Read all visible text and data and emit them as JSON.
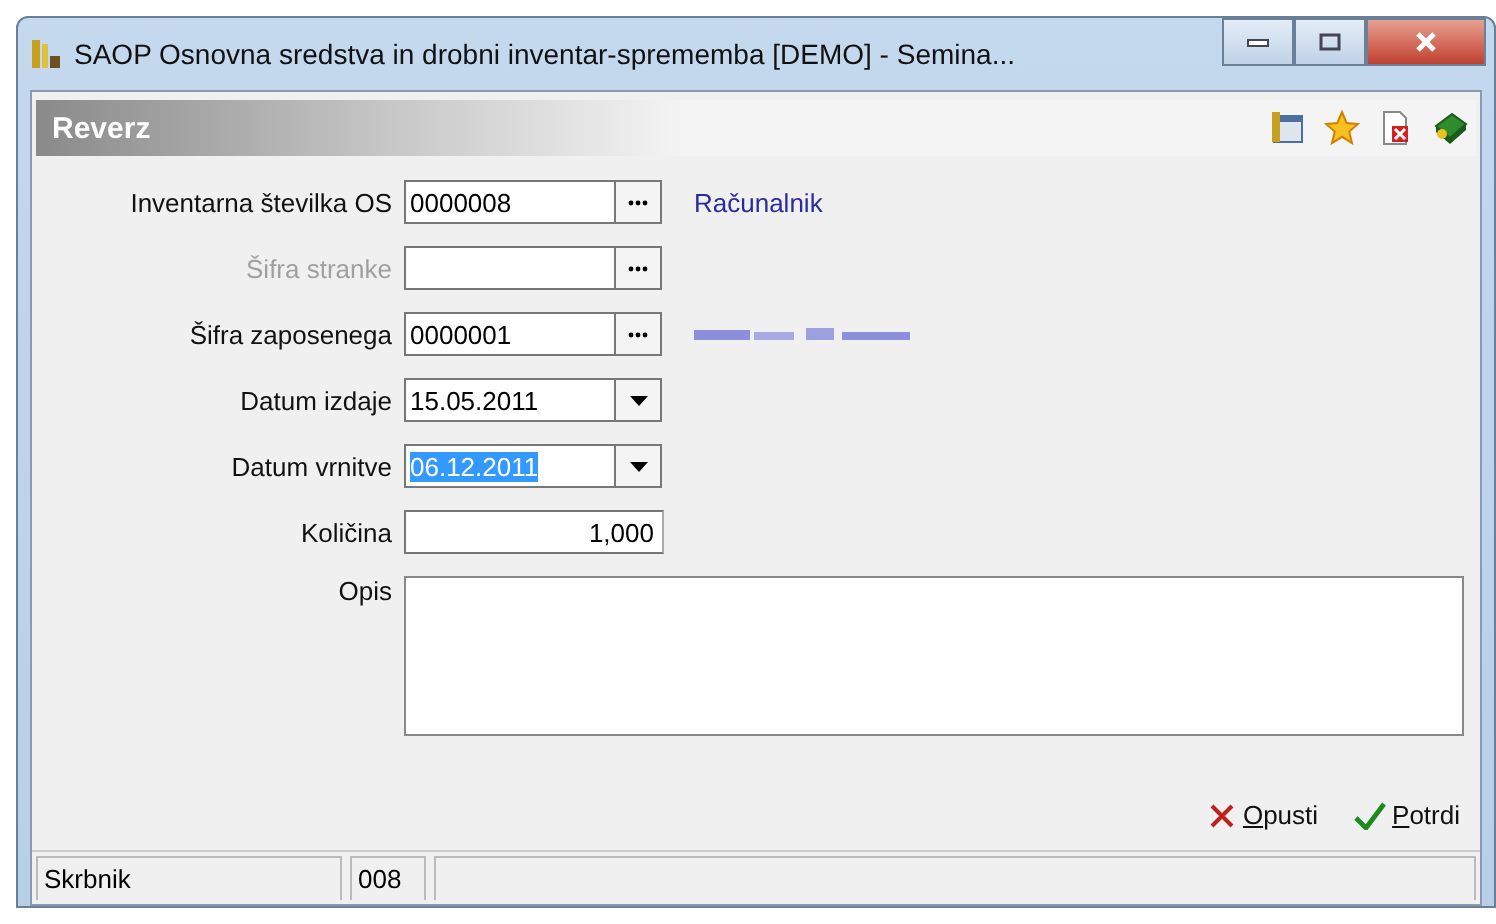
{
  "window": {
    "title": "SAOP Osnovna sredstva in drobni inventar-sprememba [DEMO] - Semina..."
  },
  "panel": {
    "title": "Reverz"
  },
  "fields": [
    {
      "kind": "lookup",
      "label": "Inventarna številka OS",
      "value": "0000008",
      "disabled": false,
      "description": "Računalnik"
    },
    {
      "kind": "lookup",
      "label": "Šifra stranke",
      "disabled": true
    },
    {
      "kind": "lookup",
      "label": "Šifra zaposenega",
      "value": "0000001",
      "disabled": false,
      "redacted": true
    },
    {
      "kind": "date",
      "label": "Datum izdaje",
      "value": "15.05.2011",
      "selected": false
    },
    {
      "kind": "date",
      "label": "Datum vrnitve",
      "value": "06.12.2011",
      "selected": true
    },
    {
      "kind": "number",
      "label": "Količina",
      "value": "1,000"
    },
    {
      "kind": "memo",
      "label": "Opis"
    }
  ],
  "buttons": [
    {
      "kind": "cancel",
      "label": "Opusti"
    },
    {
      "kind": "confirm",
      "label": "Potrdi"
    }
  ],
  "status_bar": [
    "Skrbnik",
    "008"
  ]
}
